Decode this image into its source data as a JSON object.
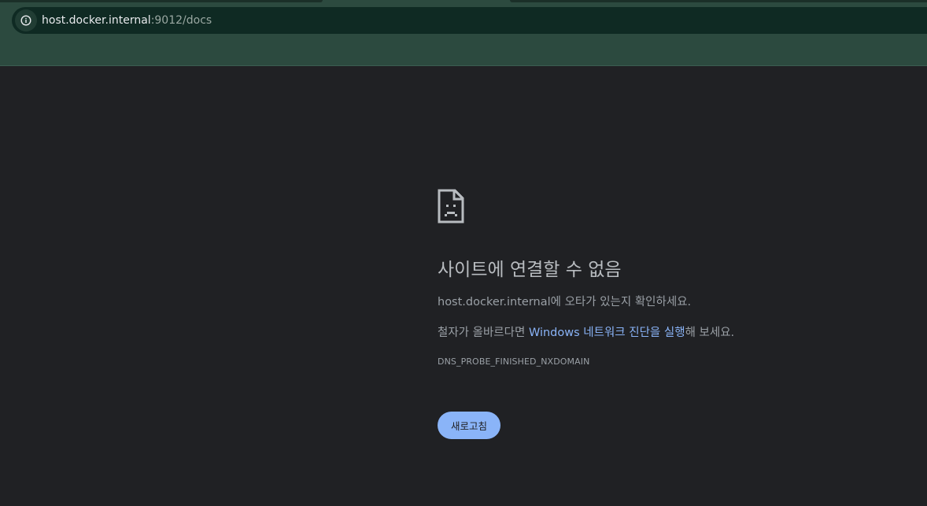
{
  "browser": {
    "url_host": "host.docker.internal",
    "url_path": ":9012/docs",
    "site_info_icon": "info-icon"
  },
  "error": {
    "icon": "sad-page-icon",
    "title": "사이트에 연결할 수 없음",
    "check_host": "host.docker.internal",
    "check_suffix": "에 오타가 있는지 확인하세요.",
    "spelling_prefix": "철자가 올바르다면 ",
    "diagnostics_link": "Windows 네트워크 진단을 실행",
    "spelling_suffix": "해 보세요.",
    "code": "DNS_PROBE_FINISHED_NXDOMAIN",
    "reload_label": "새로고침"
  },
  "colors": {
    "toolbar": "#2c4a3f",
    "omnibox": "#0f2a23",
    "page_bg": "#202124",
    "link": "#8ab4f8",
    "button": "#8ab4f8"
  }
}
